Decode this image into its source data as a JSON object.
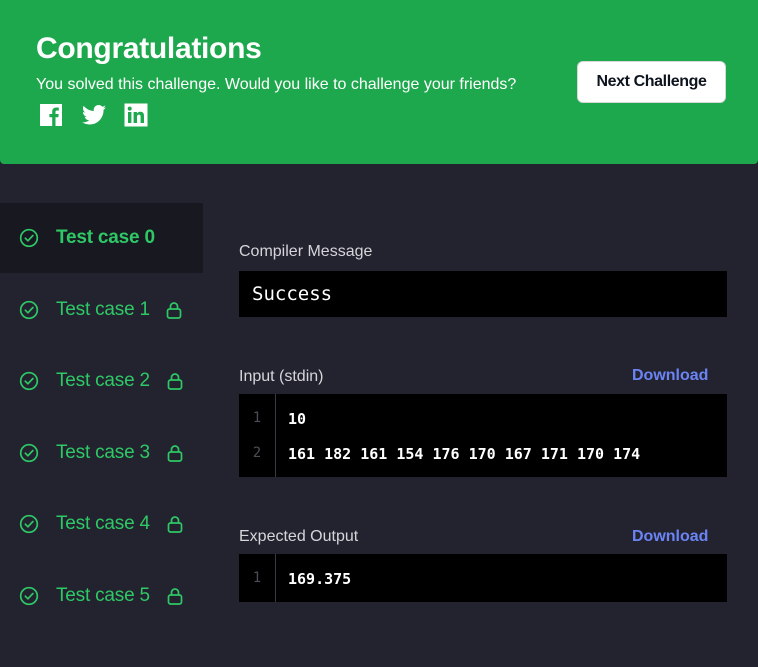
{
  "banner": {
    "title": "Congratulations",
    "subtitle": "You solved this challenge. Would you like to challenge your friends?",
    "next_button": "Next Challenge",
    "social": [
      "facebook-icon",
      "twitter-icon",
      "linkedin-icon"
    ],
    "color": "#1ea84d"
  },
  "test_cases": [
    {
      "label": "Test case 0",
      "active": true,
      "locked": false,
      "passed": true
    },
    {
      "label": "Test case 1",
      "active": false,
      "locked": true,
      "passed": true
    },
    {
      "label": "Test case 2",
      "active": false,
      "locked": true,
      "passed": true
    },
    {
      "label": "Test case 3",
      "active": false,
      "locked": true,
      "passed": true
    },
    {
      "label": "Test case 4",
      "active": false,
      "locked": true,
      "passed": true
    },
    {
      "label": "Test case 5",
      "active": false,
      "locked": true,
      "passed": true
    }
  ],
  "compiler": {
    "label": "Compiler Message",
    "message": "Success"
  },
  "input": {
    "label": "Input (stdin)",
    "download": "Download",
    "lines": [
      {
        "num": "1",
        "text": "10"
      },
      {
        "num": "2",
        "text": "161 182 161 154 176 170 167 171 170 174"
      }
    ]
  },
  "expected": {
    "label": "Expected Output",
    "download": "Download",
    "lines": [
      {
        "num": "1",
        "text": "169.375"
      }
    ]
  },
  "colors": {
    "success": "#2ec866",
    "link": "#6b84f5",
    "background": "#23232f"
  }
}
